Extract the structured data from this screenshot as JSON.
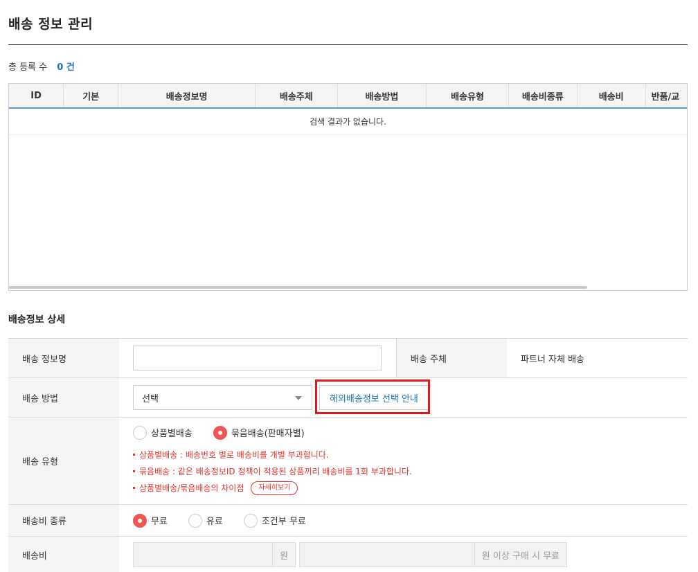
{
  "page": {
    "title": "배송 정보 관리"
  },
  "summary": {
    "label": "총 등록 수",
    "count": "0 건"
  },
  "grid": {
    "columns": [
      "ID",
      "기본",
      "배송정보명",
      "배송주체",
      "배송방법",
      "배송유형",
      "배송비종류",
      "배송비",
      "반품/교"
    ],
    "empty_message": "검색 결과가 없습니다."
  },
  "detail": {
    "section_title": "배송정보 상세",
    "name": {
      "label": "배송 정보명",
      "value": "",
      "placeholder": ""
    },
    "owner": {
      "label": "배송 주체",
      "value": "파트너 자체 배송"
    },
    "method": {
      "label": "배송 방법",
      "selected": "선택",
      "guide_button": "해외배송정보 선택 안내"
    },
    "type": {
      "label": "배송 유형",
      "options": [
        {
          "label": "상품별배송",
          "checked": false
        },
        {
          "label": "묶음배송(판매자별)",
          "checked": true
        }
      ],
      "notes": [
        "상품별배송 : 배송번호 별로 배송비를 개별 부과합니다.",
        "묶음배송 : 같은 배송정보ID 정책이 적용된 상품끼리 배송비를 1회 부과합니다.",
        "상품별배송/묶음배송의 차이점"
      ],
      "detail_button": "자세히보기"
    },
    "fee_kind": {
      "label": "배송비 종류",
      "options": [
        {
          "label": "무료",
          "checked": true
        },
        {
          "label": "유료",
          "checked": false
        },
        {
          "label": "조건부 무료",
          "checked": false
        }
      ]
    },
    "fee": {
      "label": "배송비",
      "unit1": "원",
      "unit2": "원 이상 구매 시 무료"
    }
  },
  "colors": {
    "accent_blue": "#1e73be",
    "highlight_red": "#e3191f",
    "radio_on": "#f05454",
    "note_red": "#e0352b"
  }
}
